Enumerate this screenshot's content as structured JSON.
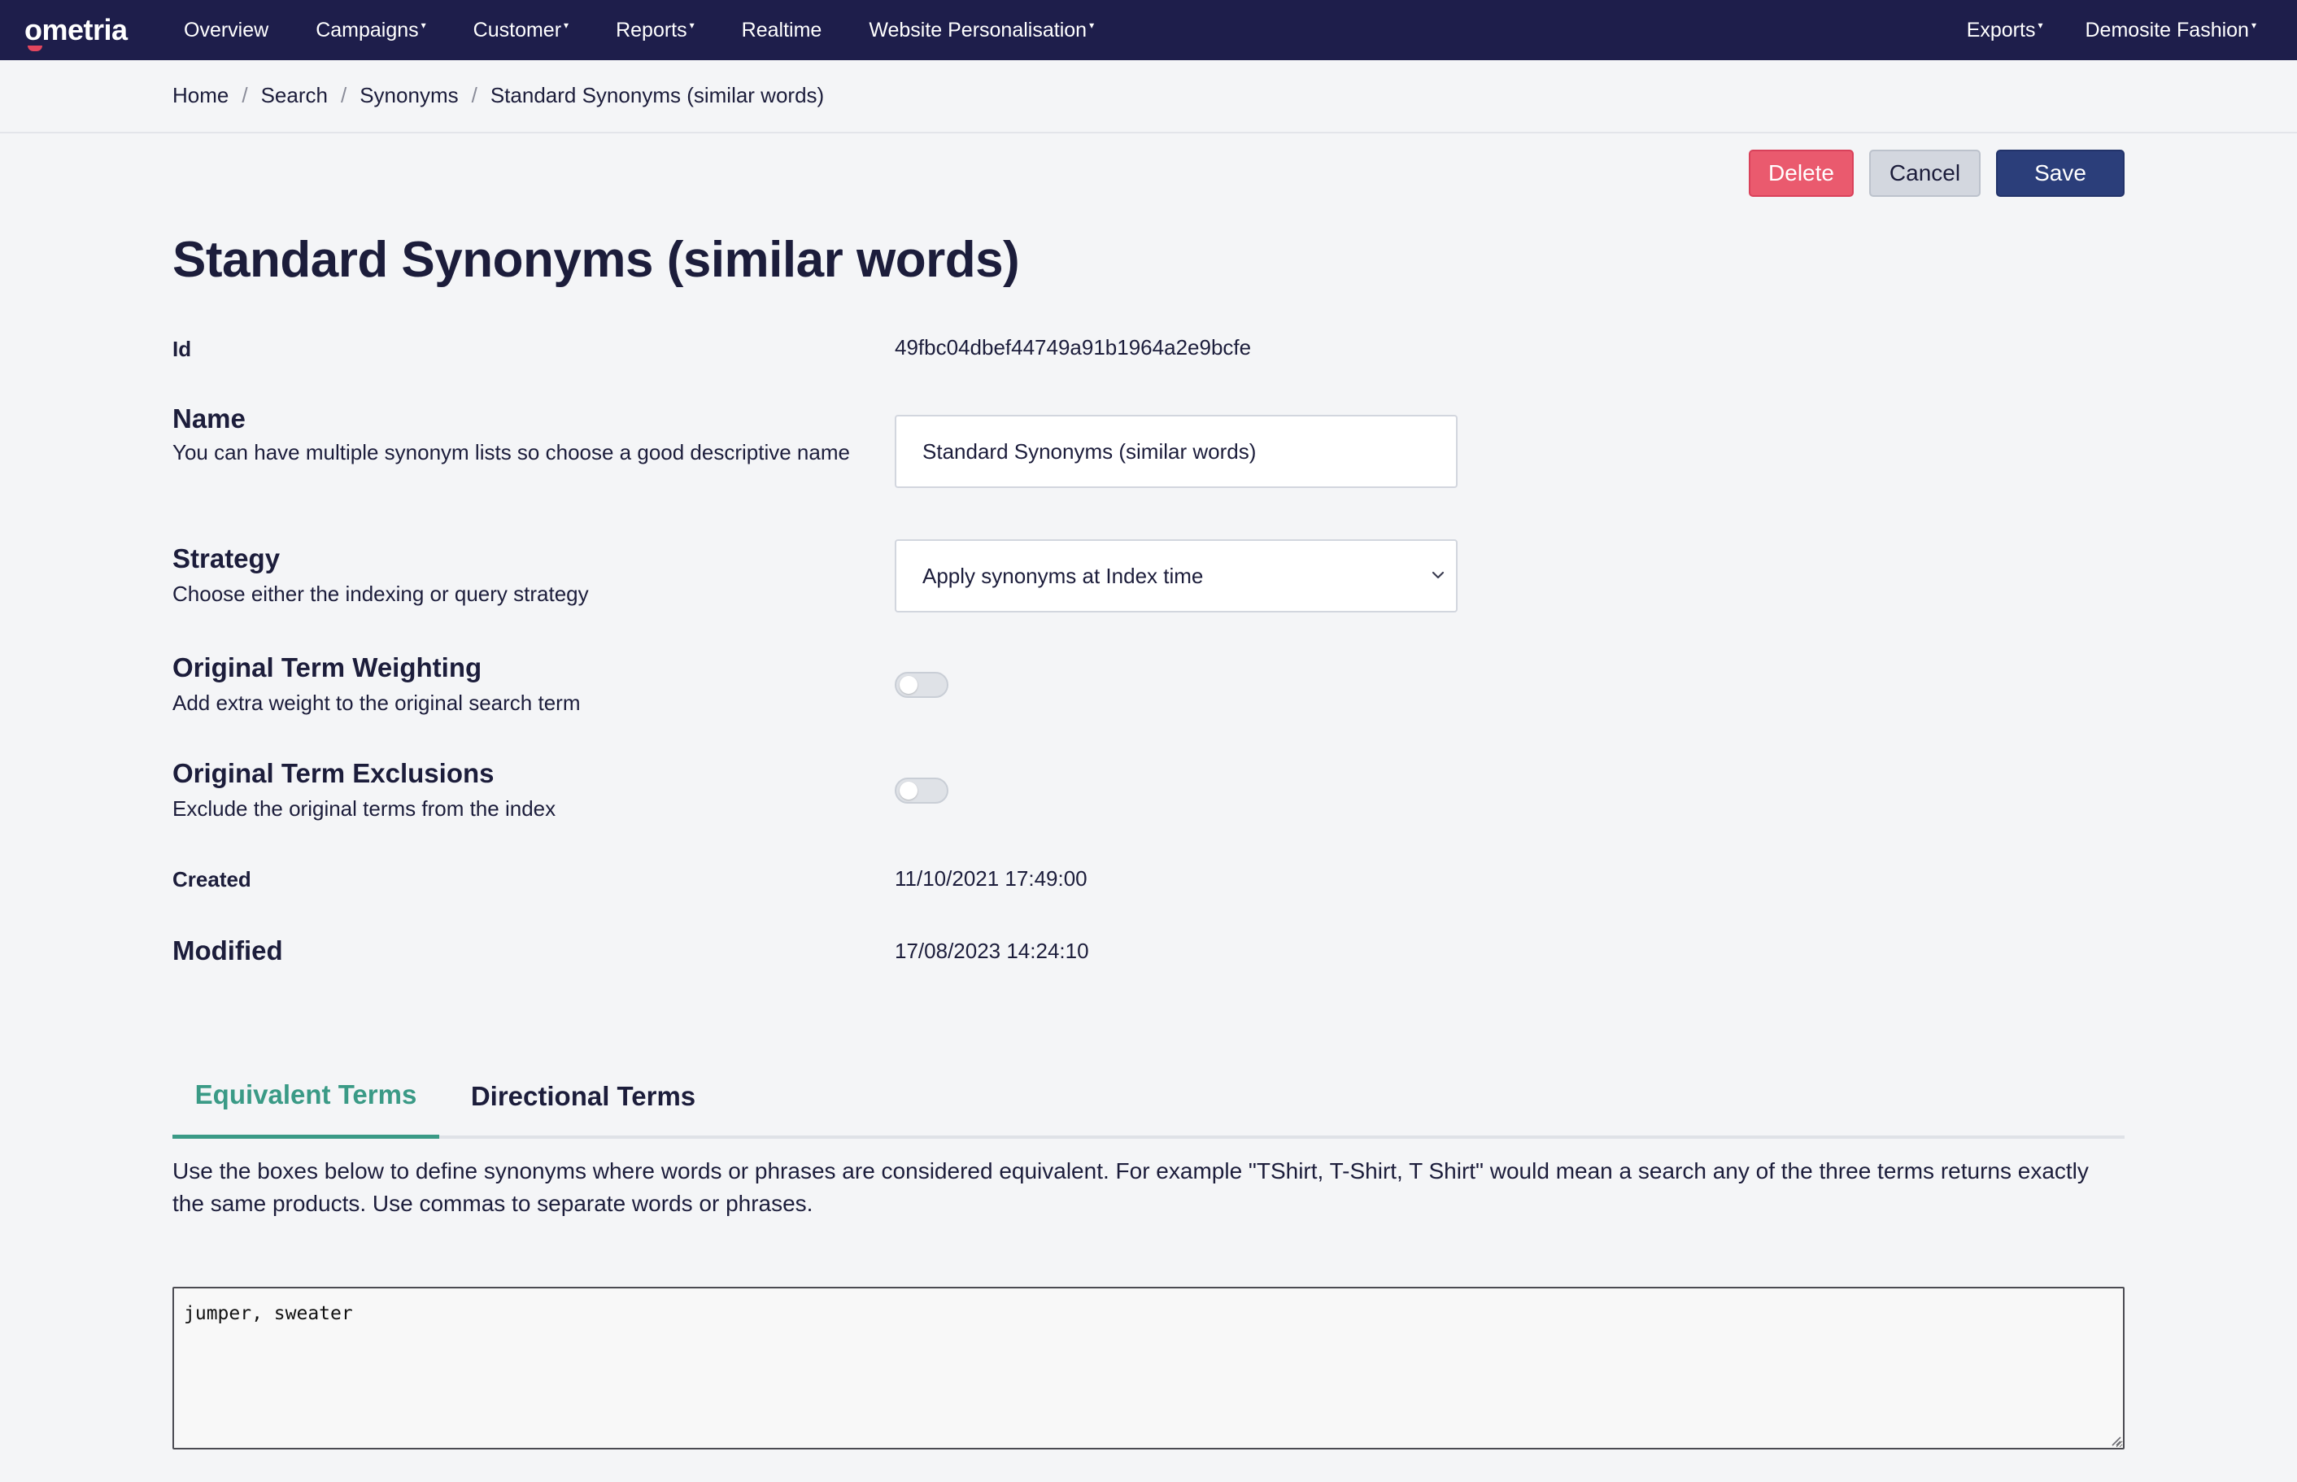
{
  "app": {
    "logo_text": "ometria",
    "brand_color": "#1e1e4b",
    "accent_color": "#3a9a86"
  },
  "nav": {
    "left_items": [
      {
        "label": "Overview",
        "dropdown": false
      },
      {
        "label": "Campaigns",
        "dropdown": true
      },
      {
        "label": "Customer",
        "dropdown": true
      },
      {
        "label": "Reports",
        "dropdown": true
      },
      {
        "label": "Realtime",
        "dropdown": false
      },
      {
        "label": "Website Personalisation",
        "dropdown": true
      }
    ],
    "right_items": [
      {
        "label": "Exports",
        "dropdown": true
      },
      {
        "label": "Demosite Fashion",
        "dropdown": true
      }
    ],
    "caret_glyph": "▾"
  },
  "breadcrumb": {
    "items": [
      "Home",
      "Search",
      "Synonyms",
      "Standard Synonyms (similar words)"
    ],
    "separator": "/"
  },
  "actions": {
    "delete_label": "Delete",
    "cancel_label": "Cancel",
    "save_label": "Save"
  },
  "page": {
    "title": "Standard Synonyms (similar words)"
  },
  "form": {
    "id": {
      "label": "Id",
      "value": "49fbc04dbef44749a91b1964a2e9bcfe"
    },
    "name": {
      "label": "Name",
      "description": "You can have multiple synonym lists so choose a good descriptive name",
      "value": "Standard Synonyms (similar words)"
    },
    "strategy": {
      "label": "Strategy",
      "description": "Choose either the indexing or query strategy",
      "selected": "Apply synonyms at Index time"
    },
    "original_term_weighting": {
      "label": "Original Term Weighting",
      "description": "Add extra weight to the original search term",
      "enabled": false
    },
    "original_term_exclusions": {
      "label": "Original Term Exclusions",
      "description": "Exclude the original terms from the index",
      "enabled": false
    },
    "created": {
      "label": "Created",
      "value": "11/10/2021 17:49:00"
    },
    "modified": {
      "label": "Modified",
      "value": "17/08/2023 14:24:10"
    }
  },
  "tabs": {
    "items": [
      {
        "label": "Equivalent Terms",
        "active": true
      },
      {
        "label": "Directional Terms",
        "active": false
      }
    ],
    "equivalent_description": "Use the boxes below to define synonyms where words or phrases are considered equivalent. For example \"TShirt, T-Shirt, T Shirt\" would mean a search any of the three terms returns exactly the same products. Use commas to separate words or phrases.",
    "terms_value": "jumper, sweater"
  }
}
